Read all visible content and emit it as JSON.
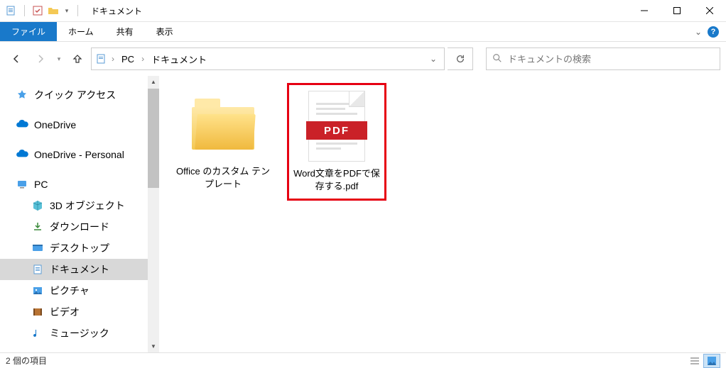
{
  "title": "ドキュメント",
  "ribbon": {
    "file": "ファイル",
    "home": "ホーム",
    "share": "共有",
    "view": "表示"
  },
  "breadcrumb": {
    "pc": "PC",
    "folder": "ドキュメント"
  },
  "search": {
    "placeholder": "ドキュメントの検索"
  },
  "sidebar": {
    "quick": "クイック アクセス",
    "od1": "OneDrive",
    "od2": "OneDrive - Personal",
    "pc": "PC",
    "objects3d": "3D オブジェクト",
    "downloads": "ダウンロード",
    "desktop": "デスクトップ",
    "documents": "ドキュメント",
    "pictures": "ピクチャ",
    "videos": "ビデオ",
    "music": "ミュージック"
  },
  "items": {
    "folder1": "Office のカスタム テンプレート",
    "file1": "Word文章をPDFで保存する.pdf",
    "pdf_label": "PDF"
  },
  "status": "2 個の項目"
}
